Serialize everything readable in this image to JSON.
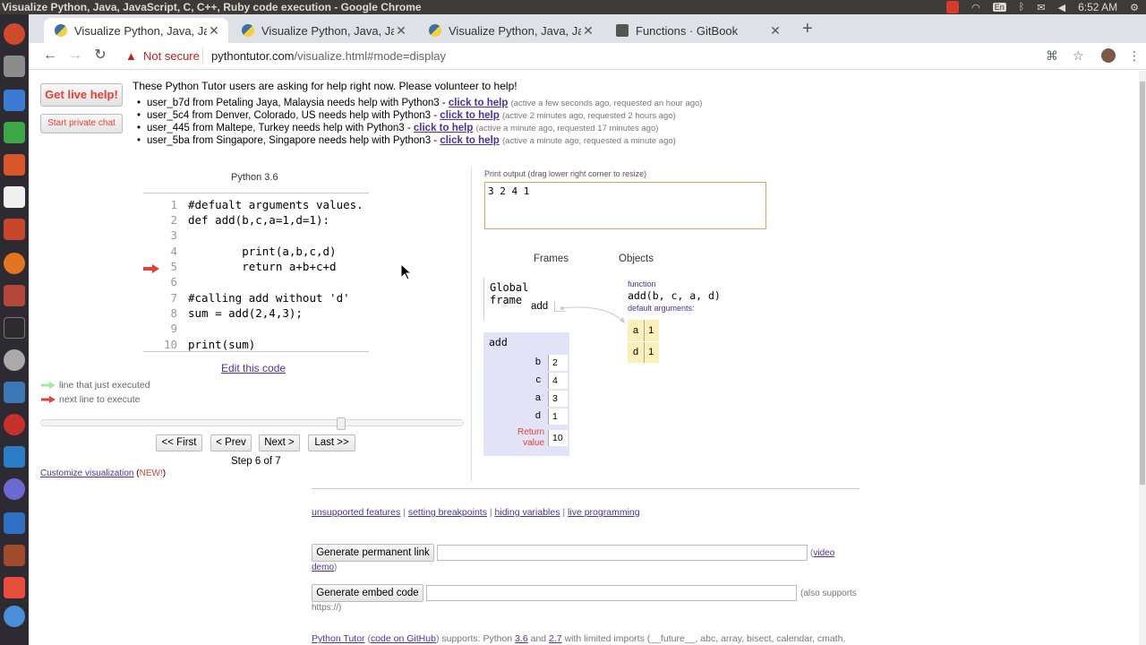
{
  "os": {
    "window_title": "Visualize Python, Java, JavaScript, C, C++, Ruby code execution - Google Chrome",
    "input_lang": "En",
    "clock": "6:52 AM"
  },
  "tabs": [
    {
      "title": "Visualize Python, Java, Ja",
      "active": true
    },
    {
      "title": "Visualize Python, Java, Ja",
      "active": false
    },
    {
      "title": "Visualize Python, Java, Ja",
      "active": false
    },
    {
      "title": "Functions · GitBook",
      "active": false
    }
  ],
  "toolbar": {
    "security": "Not secure",
    "url_host": "pythontutor.com",
    "url_path": "/visualize.html#mode=display"
  },
  "help": {
    "get_help": "Get live help!",
    "private_chat": "Start private chat",
    "heading": "These Python Tutor users are asking for help right now. Please volunteer to help!",
    "click_label": "click to help",
    "requests": [
      {
        "text": "user_b7d from Petaling Jaya, Malaysia needs help with Python3 - ",
        "meta": "(active a few seconds ago, requested an hour ago)"
      },
      {
        "text": "user_5c4 from Denver, Colorado, US needs help with Python3 - ",
        "meta": "(active 2 minutes ago, requested 2 hours ago)"
      },
      {
        "text": "user_445 from Maltepe, Turkey needs help with Python3 - ",
        "meta": "(active a minute ago, requested 17 minutes ago)"
      },
      {
        "text": "user_5ba from Singapore, Singapore needs help with Python3 - ",
        "meta": "(active a minute ago, requested a minute ago)"
      }
    ]
  },
  "editor": {
    "language": "Python 3.6",
    "lines": [
      {
        "n": "1",
        "code": "#defualt arguments values."
      },
      {
        "n": "2",
        "code": "def add(b,c,a=1,d=1):"
      },
      {
        "n": "3",
        "code": ""
      },
      {
        "n": "4",
        "code": "        print(a,b,c,d)"
      },
      {
        "n": "5",
        "code": "        return a+b+c+d"
      },
      {
        "n": "6",
        "code": ""
      },
      {
        "n": "7",
        "code": "#calling add without 'd'"
      },
      {
        "n": "8",
        "code": "sum = add(2,4,3);"
      },
      {
        "n": "9",
        "code": ""
      },
      {
        "n": "10",
        "code": "print(sum)"
      }
    ],
    "edit_link": "Edit this code",
    "legend_executed": "line that just executed",
    "legend_next": "next line to execute",
    "colors": {
      "executed": "#a6e8a0",
      "next": "#e93f34"
    }
  },
  "controls": {
    "first": "<< First",
    "prev": "< Prev",
    "next": "Next >",
    "last": "Last >>",
    "step": "Step 6 of 7",
    "step_current": 6,
    "step_total": 7
  },
  "customize": {
    "link": "Customize visualization",
    "new": "NEW!"
  },
  "output": {
    "label": "Print output (drag lower right corner to resize)",
    "text": "3 2 4 1"
  },
  "viz": {
    "frames_head": "Frames",
    "objects_head": "Objects",
    "global_frame": "Global frame",
    "global_var": "add",
    "add_frame": "add",
    "add_vars": [
      {
        "name": "b",
        "value": "2"
      },
      {
        "name": "c",
        "value": "4"
      },
      {
        "name": "a",
        "value": "3"
      },
      {
        "name": "d",
        "value": "1"
      }
    ],
    "return_label": "Return value",
    "return_value": "10",
    "func_kind": "function",
    "func_sig": "add(b, c, a, d)",
    "defaults_label": "default arguments:",
    "defaults": [
      {
        "name": "a",
        "value": "1"
      },
      {
        "name": "d",
        "value": "1"
      }
    ]
  },
  "links": {
    "unsupported": "unsupported features",
    "breakpoints": "setting breakpoints",
    "hiding": "hiding variables",
    "live": "live programming"
  },
  "generate": {
    "permalink": "Generate permanent link",
    "video": "video",
    "demo": "demo",
    "embed": "Generate embed code",
    "also_supports": "(also supports",
    "https": "https://)"
  },
  "footer": {
    "python_tutor": "Python Tutor",
    "github": "code on GitHub",
    "supports": ") supports: Python ",
    "v36": "3.6",
    "and": " and ",
    "v27": "2.7",
    "rest": " with limited imports (__future__, abc, array, bisect, calendar, cmath,"
  }
}
